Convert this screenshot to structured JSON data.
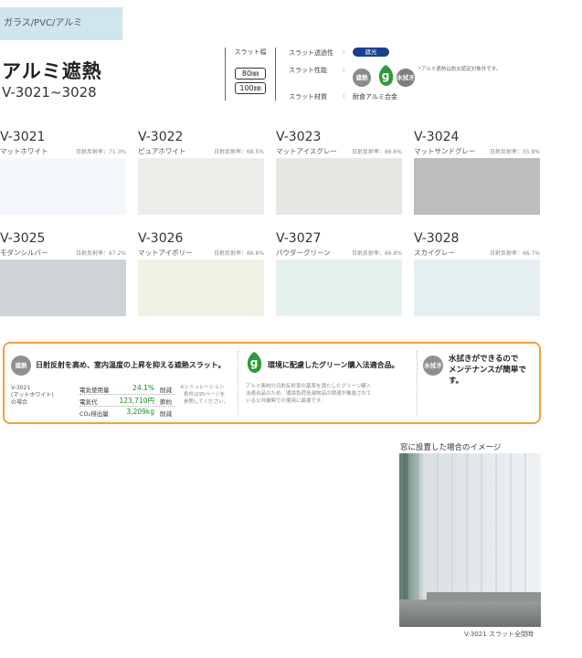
{
  "header": {
    "category_tag": "ガラス/PVC/アルミ",
    "title": "アルミ遮熱",
    "model_range": "V-3021~3028"
  },
  "specs": {
    "slat_width_label": "スラット幅",
    "slat_widths": [
      "80㎜",
      "100㎜"
    ],
    "transmittance_label": "スラット透過性",
    "transmittance_value": "遮光",
    "performance_label": "スラット性能",
    "material_label": "スラット材質",
    "material_value": "耐食アルミ合金",
    "colon": ":",
    "badges": {
      "heat": "遮熱",
      "water": "水拭き"
    },
    "green_icon_letter": "g",
    "note": "*アルミ遮熱は防炎認定対象外です。"
  },
  "swatches": [
    {
      "code": "V-3021",
      "name": "マットホワイト",
      "reflectance": "日射反射率：71.3%",
      "color": "#f3f7fb"
    },
    {
      "code": "V-3022",
      "name": "ピュアホワイト",
      "reflectance": "日射反射率：68.5%",
      "color": "#eeece8"
    },
    {
      "code": "V-3023",
      "name": "マットアイスグレー",
      "reflectance": "日射反射率：66.6%",
      "color": "#e6e6e3"
    },
    {
      "code": "V-3024",
      "name": "マットサンドグレー",
      "reflectance": "日射反射率：55.8%",
      "color": "#bdbdbc"
    },
    {
      "code": "V-3025",
      "name": "モダンシルバー",
      "reflectance": "日射反射率：67.2%",
      "color": "#cdd3d6"
    },
    {
      "code": "V-3026",
      "name": "マットアイボリー",
      "reflectance": "日射反射率：66.8%",
      "color": "#f2f2e4"
    },
    {
      "code": "V-3027",
      "name": "パウダーグリーン",
      "reflectance": "日射反射率：66.8%",
      "color": "#e4f1ec"
    },
    {
      "code": "V-3028",
      "name": "スカイグレー",
      "reflectance": "日射反射率：66.7%",
      "color": "#e5eff2"
    }
  ],
  "info": {
    "heat_badge": "遮熱",
    "heat_heading": "日射反射を高め、室内温度の上昇を抑える遮熱スラット。",
    "sample_lines": [
      "V-3021",
      "(マットホワイト)",
      "の場合"
    ],
    "eco_rows": [
      {
        "label": "電気使用量",
        "value": "24.1%",
        "unit": "削減"
      },
      {
        "label": "電気代",
        "value": "123,710円",
        "unit": "節約"
      },
      {
        "label": "CO₂排出量",
        "value": "3,209kg",
        "unit": "削減"
      }
    ],
    "sim_note": [
      "※シミュレーション",
      "条件は95ページを",
      "参照してください。"
    ],
    "green_heading": "環境に配慮したグリーン購入法適合品。",
    "green_body": [
      "アルミ素材の日射反射率の基準を満たしたグリーン購入",
      "法適合品のため、環境負荷低減物品の調達が推進されて",
      "いる公共機関での使用に最適です。"
    ],
    "water_badge": "水拭き",
    "water_heading": [
      "水拭きができるので",
      "メンテナンスが簡単です。"
    ]
  },
  "photo": {
    "caption": "窓に設置した場合のイメージ",
    "subcaption": "V-3021 スラット全閉時"
  },
  "colors": {
    "tag_bg": "#cfe6ef",
    "pill_bg": "#1c3f8c",
    "box_border": "#f0a13a",
    "eco_green": "#1a8a1a",
    "leaf_green": "#2e9a3a"
  }
}
